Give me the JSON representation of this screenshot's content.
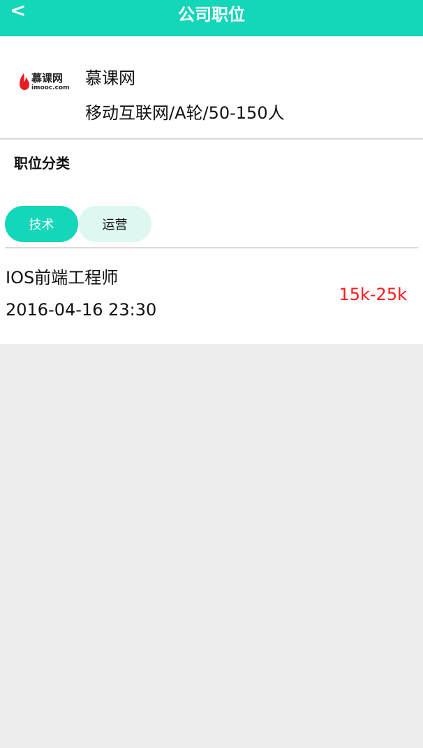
{
  "header": {
    "back_label": "<",
    "title": "公司职位"
  },
  "company": {
    "name": "慕课网",
    "meta": "移动互联网/A轮/50-150人",
    "logo_text": "慕课网",
    "logo_subtext": "imooc.com"
  },
  "positions": {
    "section_title": "职位分类",
    "tabs": [
      {
        "label": "技术",
        "active": true
      },
      {
        "label": "运营",
        "active": false
      }
    ],
    "jobs": [
      {
        "title": "IOS前端工程师",
        "date": "2016-04-16 23:30",
        "salary": "15k-25k"
      }
    ]
  },
  "colors": {
    "accent": "#14d6b9",
    "salary": "#ff1b1b",
    "tab_inactive": "#dff7f2",
    "background": "#ededed"
  }
}
